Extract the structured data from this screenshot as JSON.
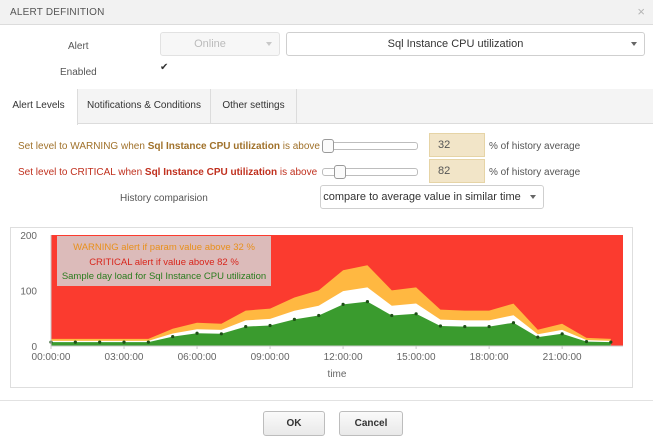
{
  "dialog": {
    "title": "ALERT DEFINITION",
    "close_glyph": "×"
  },
  "form": {
    "alert_label": "Alert",
    "status_value": "Online",
    "alert_value": "Sql Instance CPU utilization",
    "enabled_label": "Enabled",
    "enabled_checked": true,
    "check_glyph": "✔"
  },
  "tabs": [
    {
      "label": "Alert Levels",
      "active": true
    },
    {
      "label": "Notifications & Conditions",
      "active": false
    },
    {
      "label": "Other settings",
      "active": false
    }
  ],
  "levels": {
    "warning": {
      "prefix": "Set level to WARNING when ",
      "param": "Sql Instance CPU utilization",
      "suffix": " is above",
      "value": "32",
      "unit": "% of history average",
      "slider_fraction": 0.03
    },
    "critical": {
      "prefix": "Set level to CRITICAL when ",
      "param": "Sql Instance CPU utilization",
      "suffix": " is above",
      "value": "82",
      "unit": "% of history average",
      "slider_fraction": 0.1
    },
    "history_label": "History comparision",
    "history_value": "compare to average value in similar time"
  },
  "colors": {
    "critical_zone": "#fb3b2f",
    "warning_zone": "#ffb841",
    "load_series": "#3a9b2e",
    "legend_warning": "#e8901c",
    "legend_critical": "#d8261c",
    "legend_sample": "#2a7c1e"
  },
  "chart_data": {
    "type": "area",
    "xlabel": "time",
    "ylabel": "",
    "ylim": [
      0,
      200
    ],
    "yticks": [
      0,
      100,
      200
    ],
    "xlim_hours": [
      0,
      23.5
    ],
    "xtick_labels": [
      "00:00:00",
      "03:00:00",
      "06:00:00",
      "09:00:00",
      "12:00:00",
      "15:00:00",
      "18:00:00",
      "21:00:00"
    ],
    "legend": [
      "WARNING alert if param value above 32 %",
      "CRITICAL alert if value above 82 %",
      "Sample day load for Sql Instance CPU utilization"
    ],
    "series": [
      {
        "name": "Sample day load for Sql Instance CPU utilization",
        "hours": [
          0,
          1,
          2,
          3,
          4,
          5,
          6,
          7,
          8,
          9,
          10,
          11,
          12,
          13,
          14,
          15,
          16,
          17,
          18,
          19,
          20,
          21,
          22,
          23
        ],
        "values": [
          7,
          7,
          7,
          7,
          7,
          17,
          23,
          22,
          35,
          37,
          48,
          55,
          75,
          80,
          55,
          58,
          36,
          35,
          35,
          42,
          16,
          22,
          8,
          7
        ]
      }
    ],
    "warning_multiplier": 1.32,
    "critical_multiplier": 1.82
  },
  "footer": {
    "ok_label": "OK",
    "cancel_label": "Cancel"
  }
}
